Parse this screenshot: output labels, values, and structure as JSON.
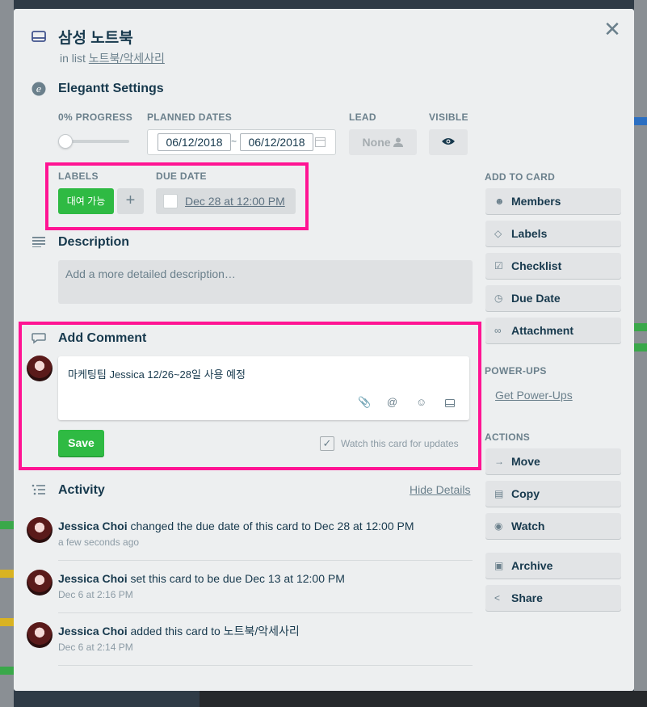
{
  "card": {
    "title": "삼성 노트북",
    "in_list_prefix": "in list",
    "list_name": "노트북/악세사리"
  },
  "elegantt": {
    "title": "Elegantt Settings",
    "progress_label": "0% PROGRESS",
    "progress_value": 0,
    "planned_dates_label": "PLANNED DATES",
    "start_date": "06/12/2018",
    "end_date": "06/12/2018",
    "date_separator": "~",
    "lead_label": "LEAD",
    "lead_value": "None",
    "visible_label": "VISIBLE"
  },
  "labels_section": {
    "labels_title": "LABELS",
    "label_text": "대여 가능",
    "label_color": "#2fba43",
    "add_symbol": "+",
    "due_date_title": "DUE DATE",
    "due_date_value": "Dec 28 at 12:00 PM"
  },
  "description": {
    "title": "Description",
    "placeholder": "Add a more detailed description…"
  },
  "comment": {
    "title": "Add Comment",
    "text": "마케팅팀 Jessica 12/26~28일 사용 예정",
    "save_label": "Save",
    "watch_label": "Watch this card for updates"
  },
  "activity": {
    "title": "Activity",
    "hide_details": "Hide Details",
    "items": [
      {
        "user": "Jessica Choi",
        "action": "changed the due date of this card to Dec 28 at 12:00 PM",
        "time": "a few seconds ago"
      },
      {
        "user": "Jessica Choi",
        "action": "set this card to be due Dec 13 at 12:00 PM",
        "time": "Dec 6 at 2:16 PM"
      },
      {
        "user": "Jessica Choi",
        "action": "added this card to 노트북/악세사리",
        "time": "Dec 6 at 2:14 PM"
      }
    ]
  },
  "sidebar": {
    "add_to_card_title": "ADD TO CARD",
    "add_items": [
      {
        "label": "Members",
        "icon": "person-icon"
      },
      {
        "label": "Labels",
        "icon": "tag-icon"
      },
      {
        "label": "Checklist",
        "icon": "checkbox-icon"
      },
      {
        "label": "Due Date",
        "icon": "clock-icon"
      },
      {
        "label": "Attachment",
        "icon": "paperclip-icon"
      }
    ],
    "powerups_title": "POWER-UPS",
    "get_powerups": "Get Power-Ups",
    "actions_title": "ACTIONS",
    "action_items": [
      {
        "label": "Move",
        "icon": "arrow-right-icon"
      },
      {
        "label": "Copy",
        "icon": "card-icon"
      },
      {
        "label": "Watch",
        "icon": "eye-icon"
      },
      {
        "label": "Archive",
        "icon": "archive-icon"
      },
      {
        "label": "Share",
        "icon": "share-icon"
      }
    ]
  },
  "colors": {
    "highlight": "#ff1493",
    "green": "#2fba43",
    "modal_bg": "#edeff0"
  }
}
